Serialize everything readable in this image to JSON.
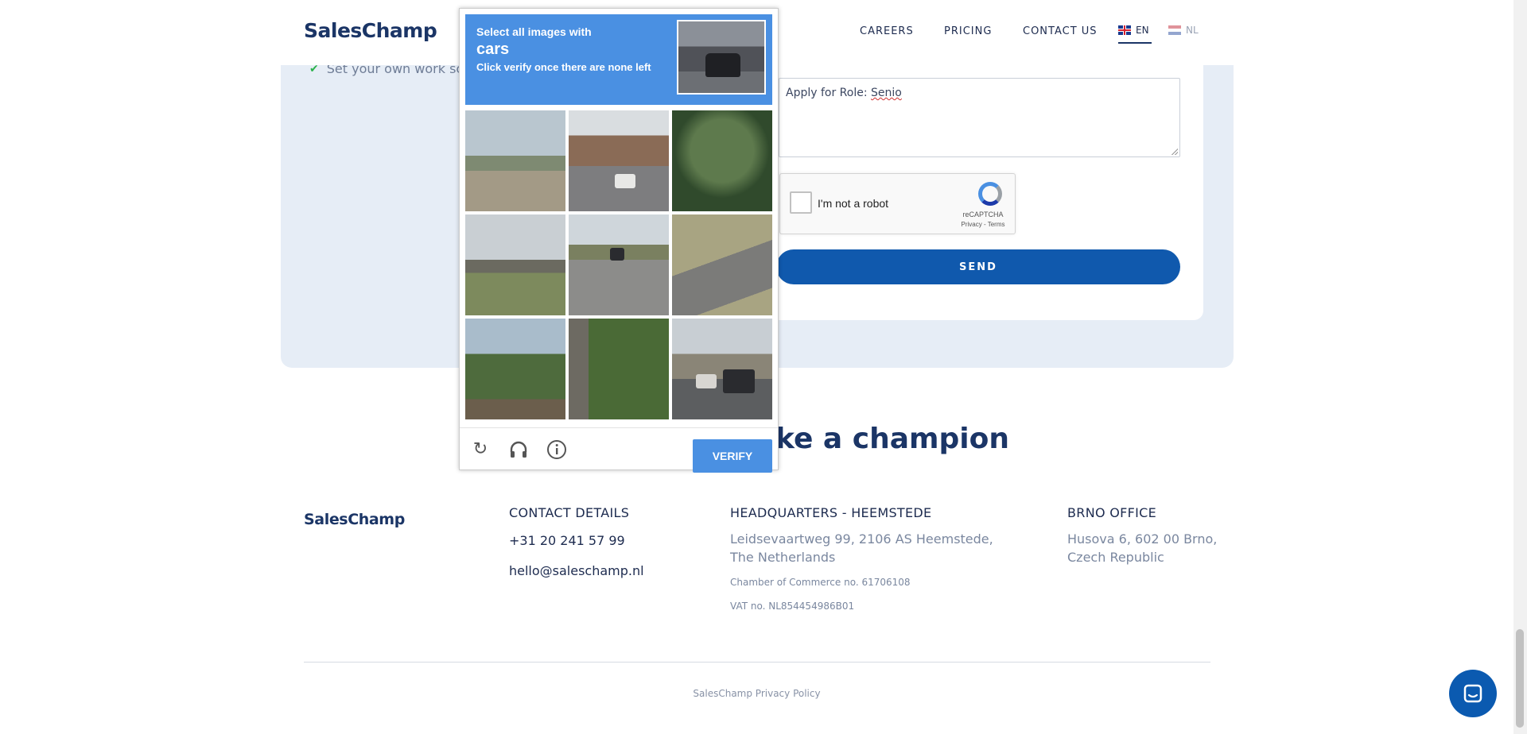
{
  "header": {
    "logo": "SalesChamp",
    "nav": {
      "careers": "CAREERS",
      "pricing": "PRICING",
      "contact": "CONTACT US"
    },
    "languages": [
      {
        "code": "EN",
        "active": true,
        "flag": "uk-flag-icon"
      },
      {
        "code": "NL",
        "active": false,
        "flag": "nl-flag-icon"
      }
    ]
  },
  "form": {
    "perk": "Set your own work schedule",
    "message_value": "Apply for Role: ",
    "message_misspelled": "Senio",
    "recaptcha": {
      "label": "I'm not a robot",
      "brand": "reCAPTCHA",
      "links": "Privacy - Terms"
    },
    "send_label": "SEND"
  },
  "champion_heading": "ke a champion",
  "captcha_challenge": {
    "instruction": "Select all images with",
    "target": "cars",
    "sub_instruction": "Click verify once there are none left",
    "tiles": [
      "tile-1",
      "tile-2",
      "tile-3",
      "tile-4",
      "tile-5",
      "tile-6",
      "tile-7",
      "tile-8",
      "tile-9"
    ],
    "controls": {
      "reload_icon": "reload-icon",
      "audio_icon": "headphones-icon",
      "info_icon": "info-icon"
    },
    "verify_label": "VERIFY",
    "accent": "#4a90e2"
  },
  "footer": {
    "logo": "SalesChamp",
    "contact": {
      "heading": "CONTACT DETAILS",
      "phone": "+31 20 241 57 99",
      "email": "hello@saleschamp.nl"
    },
    "hq": {
      "heading": "HEADQUARTERS - HEEMSTEDE",
      "address_line1": "Leidsevaartweg 99, 2106 AS Heemstede,",
      "address_line2": "The Netherlands",
      "chamber": "Chamber of Commerce no. 61706108",
      "vat": "VAT no. NL854454986B01"
    },
    "brno": {
      "heading": "BRNO OFFICE",
      "address_line1": "Husova 6, 602 00 Brno,",
      "address_line2": "Czech Republic"
    },
    "privacy": "SalesChamp Privacy Policy"
  },
  "colors": {
    "brand_dark": "#1b3566",
    "send_button": "#1059ad",
    "section_bg": "#e6edf6"
  }
}
